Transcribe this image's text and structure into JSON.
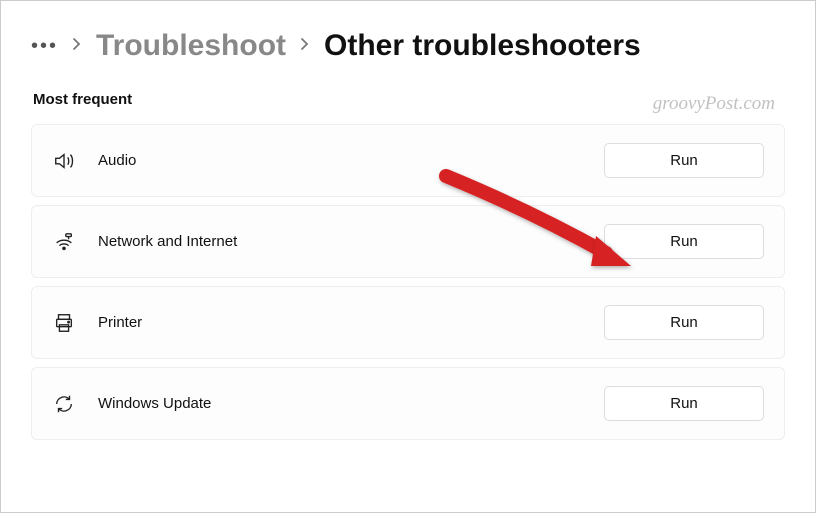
{
  "breadcrumb": {
    "overflow": "…",
    "link": "Troubleshoot",
    "current": "Other troubleshooters"
  },
  "section_title": "Most frequent",
  "watermark": "groovyPost.com",
  "items": [
    {
      "label": "Audio",
      "button": "Run"
    },
    {
      "label": "Network and Internet",
      "button": "Run"
    },
    {
      "label": "Printer",
      "button": "Run"
    },
    {
      "label": "Windows Update",
      "button": "Run"
    }
  ]
}
